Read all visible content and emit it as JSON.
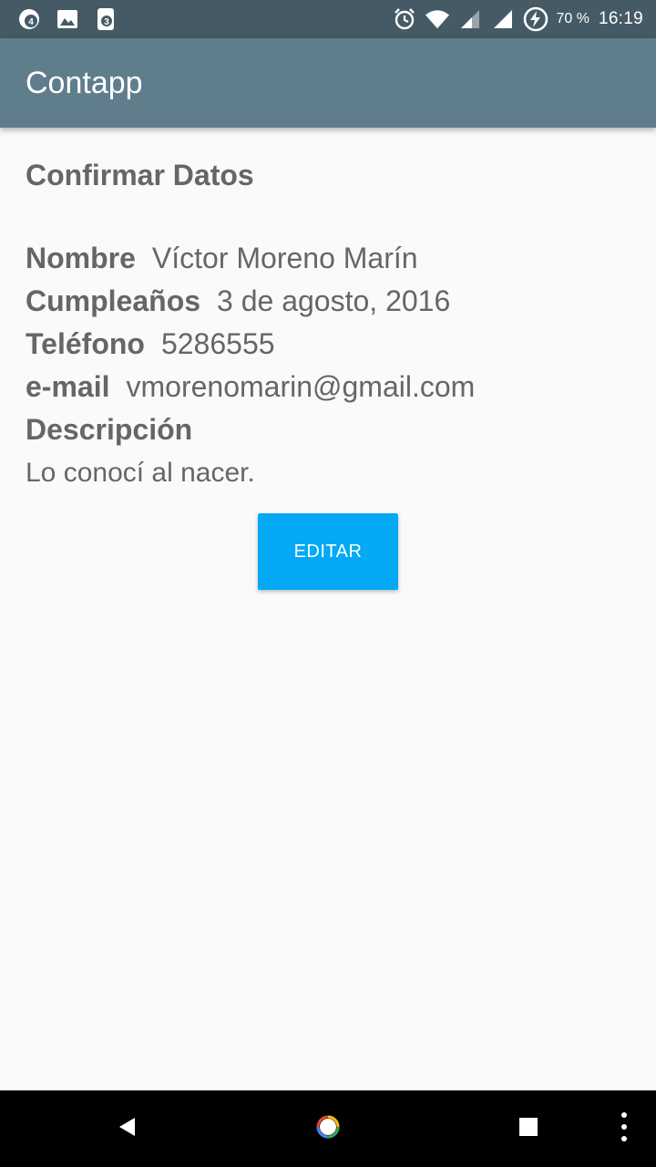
{
  "status_bar": {
    "left_icons": [
      "notification-badge-4-icon",
      "image-icon",
      "notification-badge-3-icon"
    ],
    "badge_a": "4",
    "badge_b": "3",
    "right_icons": [
      "alarm-icon",
      "wifi-icon",
      "signal-icon",
      "signal-icon",
      "battery-charging-icon"
    ],
    "battery": "70 %",
    "time": "16:19"
  },
  "app_bar": {
    "title": "Contapp"
  },
  "page": {
    "section_title": "Confirmar Datos",
    "fields": [
      {
        "label": "Nombre",
        "value": "Víctor Moreno Marín"
      },
      {
        "label": "Cumpleaños",
        "value": "3 de agosto, 2016"
      },
      {
        "label": "Teléfono",
        "value": "5286555"
      },
      {
        "label": "e-mail",
        "value": "vmorenomarin@gmail.com"
      }
    ],
    "description_label": "Descripción",
    "description_value": "Lo conocí al nacer.",
    "edit_button": "EDITAR"
  },
  "nav_bar": {
    "icons": [
      "back-icon",
      "home-icon",
      "recents-icon",
      "more-icon"
    ]
  },
  "colors": {
    "status_bar": "#455a64",
    "app_bar": "#607d8b",
    "accent": "#03a9f4",
    "text": "#666666",
    "background": "#fafafa"
  }
}
